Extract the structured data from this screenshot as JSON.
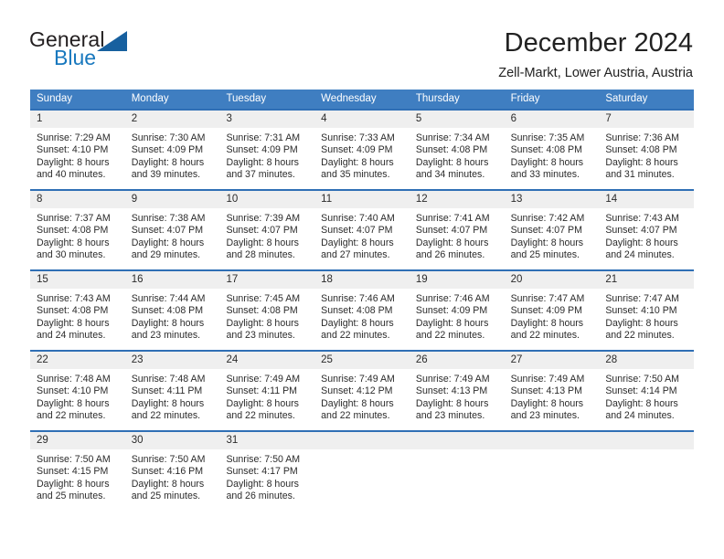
{
  "logo": {
    "primary_text": "General",
    "secondary_text": "Blue",
    "triangle_color": "#17609f",
    "blue_color": "#1878be"
  },
  "header": {
    "title": "December 2024",
    "subtitle": "Zell-Markt, Lower Austria, Austria"
  },
  "theme": {
    "header_blue": "#3f7ec1",
    "row_divider_blue": "#2f6fb5",
    "day_band_gray": "#efefef",
    "text": "#2b2b2b"
  },
  "weekdays": [
    "Sunday",
    "Monday",
    "Tuesday",
    "Wednesday",
    "Thursday",
    "Friday",
    "Saturday"
  ],
  "weeks": [
    [
      {
        "day": "1",
        "sunrise": "Sunrise: 7:29 AM",
        "sunset": "Sunset: 4:10 PM",
        "daylight_1": "Daylight: 8 hours",
        "daylight_2": "and 40 minutes."
      },
      {
        "day": "2",
        "sunrise": "Sunrise: 7:30 AM",
        "sunset": "Sunset: 4:09 PM",
        "daylight_1": "Daylight: 8 hours",
        "daylight_2": "and 39 minutes."
      },
      {
        "day": "3",
        "sunrise": "Sunrise: 7:31 AM",
        "sunset": "Sunset: 4:09 PM",
        "daylight_1": "Daylight: 8 hours",
        "daylight_2": "and 37 minutes."
      },
      {
        "day": "4",
        "sunrise": "Sunrise: 7:33 AM",
        "sunset": "Sunset: 4:09 PM",
        "daylight_1": "Daylight: 8 hours",
        "daylight_2": "and 35 minutes."
      },
      {
        "day": "5",
        "sunrise": "Sunrise: 7:34 AM",
        "sunset": "Sunset: 4:08 PM",
        "daylight_1": "Daylight: 8 hours",
        "daylight_2": "and 34 minutes."
      },
      {
        "day": "6",
        "sunrise": "Sunrise: 7:35 AM",
        "sunset": "Sunset: 4:08 PM",
        "daylight_1": "Daylight: 8 hours",
        "daylight_2": "and 33 minutes."
      },
      {
        "day": "7",
        "sunrise": "Sunrise: 7:36 AM",
        "sunset": "Sunset: 4:08 PM",
        "daylight_1": "Daylight: 8 hours",
        "daylight_2": "and 31 minutes."
      }
    ],
    [
      {
        "day": "8",
        "sunrise": "Sunrise: 7:37 AM",
        "sunset": "Sunset: 4:08 PM",
        "daylight_1": "Daylight: 8 hours",
        "daylight_2": "and 30 minutes."
      },
      {
        "day": "9",
        "sunrise": "Sunrise: 7:38 AM",
        "sunset": "Sunset: 4:07 PM",
        "daylight_1": "Daylight: 8 hours",
        "daylight_2": "and 29 minutes."
      },
      {
        "day": "10",
        "sunrise": "Sunrise: 7:39 AM",
        "sunset": "Sunset: 4:07 PM",
        "daylight_1": "Daylight: 8 hours",
        "daylight_2": "and 28 minutes."
      },
      {
        "day": "11",
        "sunrise": "Sunrise: 7:40 AM",
        "sunset": "Sunset: 4:07 PM",
        "daylight_1": "Daylight: 8 hours",
        "daylight_2": "and 27 minutes."
      },
      {
        "day": "12",
        "sunrise": "Sunrise: 7:41 AM",
        "sunset": "Sunset: 4:07 PM",
        "daylight_1": "Daylight: 8 hours",
        "daylight_2": "and 26 minutes."
      },
      {
        "day": "13",
        "sunrise": "Sunrise: 7:42 AM",
        "sunset": "Sunset: 4:07 PM",
        "daylight_1": "Daylight: 8 hours",
        "daylight_2": "and 25 minutes."
      },
      {
        "day": "14",
        "sunrise": "Sunrise: 7:43 AM",
        "sunset": "Sunset: 4:07 PM",
        "daylight_1": "Daylight: 8 hours",
        "daylight_2": "and 24 minutes."
      }
    ],
    [
      {
        "day": "15",
        "sunrise": "Sunrise: 7:43 AM",
        "sunset": "Sunset: 4:08 PM",
        "daylight_1": "Daylight: 8 hours",
        "daylight_2": "and 24 minutes."
      },
      {
        "day": "16",
        "sunrise": "Sunrise: 7:44 AM",
        "sunset": "Sunset: 4:08 PM",
        "daylight_1": "Daylight: 8 hours",
        "daylight_2": "and 23 minutes."
      },
      {
        "day": "17",
        "sunrise": "Sunrise: 7:45 AM",
        "sunset": "Sunset: 4:08 PM",
        "daylight_1": "Daylight: 8 hours",
        "daylight_2": "and 23 minutes."
      },
      {
        "day": "18",
        "sunrise": "Sunrise: 7:46 AM",
        "sunset": "Sunset: 4:08 PM",
        "daylight_1": "Daylight: 8 hours",
        "daylight_2": "and 22 minutes."
      },
      {
        "day": "19",
        "sunrise": "Sunrise: 7:46 AM",
        "sunset": "Sunset: 4:09 PM",
        "daylight_1": "Daylight: 8 hours",
        "daylight_2": "and 22 minutes."
      },
      {
        "day": "20",
        "sunrise": "Sunrise: 7:47 AM",
        "sunset": "Sunset: 4:09 PM",
        "daylight_1": "Daylight: 8 hours",
        "daylight_2": "and 22 minutes."
      },
      {
        "day": "21",
        "sunrise": "Sunrise: 7:47 AM",
        "sunset": "Sunset: 4:10 PM",
        "daylight_1": "Daylight: 8 hours",
        "daylight_2": "and 22 minutes."
      }
    ],
    [
      {
        "day": "22",
        "sunrise": "Sunrise: 7:48 AM",
        "sunset": "Sunset: 4:10 PM",
        "daylight_1": "Daylight: 8 hours",
        "daylight_2": "and 22 minutes."
      },
      {
        "day": "23",
        "sunrise": "Sunrise: 7:48 AM",
        "sunset": "Sunset: 4:11 PM",
        "daylight_1": "Daylight: 8 hours",
        "daylight_2": "and 22 minutes."
      },
      {
        "day": "24",
        "sunrise": "Sunrise: 7:49 AM",
        "sunset": "Sunset: 4:11 PM",
        "daylight_1": "Daylight: 8 hours",
        "daylight_2": "and 22 minutes."
      },
      {
        "day": "25",
        "sunrise": "Sunrise: 7:49 AM",
        "sunset": "Sunset: 4:12 PM",
        "daylight_1": "Daylight: 8 hours",
        "daylight_2": "and 22 minutes."
      },
      {
        "day": "26",
        "sunrise": "Sunrise: 7:49 AM",
        "sunset": "Sunset: 4:13 PM",
        "daylight_1": "Daylight: 8 hours",
        "daylight_2": "and 23 minutes."
      },
      {
        "day": "27",
        "sunrise": "Sunrise: 7:49 AM",
        "sunset": "Sunset: 4:13 PM",
        "daylight_1": "Daylight: 8 hours",
        "daylight_2": "and 23 minutes."
      },
      {
        "day": "28",
        "sunrise": "Sunrise: 7:50 AM",
        "sunset": "Sunset: 4:14 PM",
        "daylight_1": "Daylight: 8 hours",
        "daylight_2": "and 24 minutes."
      }
    ],
    [
      {
        "day": "29",
        "sunrise": "Sunrise: 7:50 AM",
        "sunset": "Sunset: 4:15 PM",
        "daylight_1": "Daylight: 8 hours",
        "daylight_2": "and 25 minutes."
      },
      {
        "day": "30",
        "sunrise": "Sunrise: 7:50 AM",
        "sunset": "Sunset: 4:16 PM",
        "daylight_1": "Daylight: 8 hours",
        "daylight_2": "and 25 minutes."
      },
      {
        "day": "31",
        "sunrise": "Sunrise: 7:50 AM",
        "sunset": "Sunset: 4:17 PM",
        "daylight_1": "Daylight: 8 hours",
        "daylight_2": "and 26 minutes."
      },
      {
        "day": "",
        "sunrise": "",
        "sunset": "",
        "daylight_1": "",
        "daylight_2": ""
      },
      {
        "day": "",
        "sunrise": "",
        "sunset": "",
        "daylight_1": "",
        "daylight_2": ""
      },
      {
        "day": "",
        "sunrise": "",
        "sunset": "",
        "daylight_1": "",
        "daylight_2": ""
      },
      {
        "day": "",
        "sunrise": "",
        "sunset": "",
        "daylight_1": "",
        "daylight_2": ""
      }
    ]
  ]
}
